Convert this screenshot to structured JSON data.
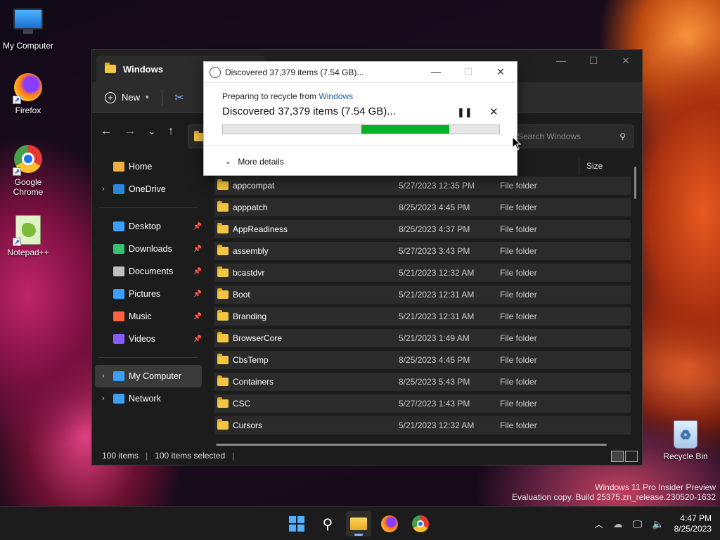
{
  "desktop": {
    "icons": [
      {
        "label": "My Computer"
      },
      {
        "label": "Firefox"
      },
      {
        "label": "Google Chrome"
      },
      {
        "label": "Notepad++"
      }
    ],
    "recycle_bin": "Recycle Bin",
    "watermark_line1": "Windows 11 Pro Insider Preview",
    "watermark_line2": "Evaluation copy. Build 25375.zn_release.230520-1632"
  },
  "explorer": {
    "tab_title": "Windows",
    "toolbar": {
      "new_label": "New"
    },
    "search_placeholder": "Search Windows",
    "column_size": "Size",
    "sidebar": [
      {
        "label": "Home",
        "icon": "home-icon",
        "expandable": false
      },
      {
        "label": "OneDrive",
        "icon": "cloud-icon",
        "expandable": true
      },
      {
        "label": "Desktop",
        "icon": "desktop-icon",
        "pinned": true
      },
      {
        "label": "Downloads",
        "icon": "download-icon",
        "pinned": true
      },
      {
        "label": "Documents",
        "icon": "document-icon",
        "pinned": true
      },
      {
        "label": "Pictures",
        "icon": "pictures-icon",
        "pinned": true
      },
      {
        "label": "Music",
        "icon": "music-icon",
        "pinned": true
      },
      {
        "label": "Videos",
        "icon": "videos-icon",
        "pinned": true
      },
      {
        "label": "My Computer",
        "icon": "computer-icon",
        "expandable": true
      },
      {
        "label": "Network",
        "icon": "network-icon",
        "expandable": true
      }
    ],
    "files": [
      {
        "name": "appcompat",
        "date": "5/27/2023 12:35 PM",
        "type": "File folder"
      },
      {
        "name": "apppatch",
        "date": "8/25/2023 4:45 PM",
        "type": "File folder"
      },
      {
        "name": "AppReadiness",
        "date": "8/25/2023 4:37 PM",
        "type": "File folder"
      },
      {
        "name": "assembly",
        "date": "5/27/2023 3:43 PM",
        "type": "File folder"
      },
      {
        "name": "bcastdvr",
        "date": "5/21/2023 12:32 AM",
        "type": "File folder"
      },
      {
        "name": "Boot",
        "date": "5/21/2023 12:31 AM",
        "type": "File folder"
      },
      {
        "name": "Branding",
        "date": "5/21/2023 12:31 AM",
        "type": "File folder"
      },
      {
        "name": "BrowserCore",
        "date": "5/21/2023 1:49 AM",
        "type": "File folder"
      },
      {
        "name": "CbsTemp",
        "date": "8/25/2023 4:45 PM",
        "type": "File folder"
      },
      {
        "name": "Containers",
        "date": "8/25/2023 5:43 PM",
        "type": "File folder"
      },
      {
        "name": "CSC",
        "date": "5/27/2023 1:43 PM",
        "type": "File folder"
      },
      {
        "name": "Cursors",
        "date": "5/21/2023 12:32 AM",
        "type": "File folder"
      }
    ],
    "status": {
      "items": "100 items",
      "selected": "100 items selected"
    }
  },
  "dialog": {
    "title": "Discovered 37,379 items (7.54 GB)...",
    "sub_prefix": "Preparing to recycle from",
    "sub_link": "Windows",
    "main": "Discovered 37,379 items (7.54 GB)...",
    "more_details": "More details",
    "progress_start": 0.5,
    "progress_end": 0.82,
    "progress_color": "#06b025"
  },
  "taskbar": {
    "time": "4:47 PM",
    "date": "8/25/2023"
  }
}
